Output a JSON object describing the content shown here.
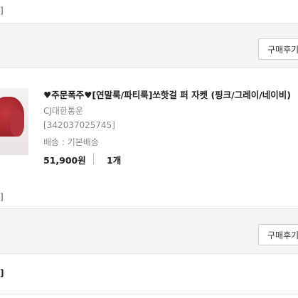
{
  "top": {
    "edge_bracket": "]"
  },
  "review_buttons": [
    {
      "label": "구매후기"
    },
    {
      "label": "구매후기"
    }
  ],
  "order_item": {
    "title": "♥주문폭주♥[연말룩/파티룩]쏘핫걸 퍼 자켓 (핑크/그레이/네이비)",
    "courier": "CJ대한통운",
    "tracking": "[342037025745]",
    "shipping": "배송 : 기본배송",
    "price": "51,900원",
    "separator": "|",
    "quantity": "1개"
  },
  "middle": {
    "edge_bracket": "]"
  },
  "bottom": {
    "edge_bracket": "]"
  },
  "colors": {
    "band": "#f4f4f4",
    "divider": "#e2e2e2",
    "muted_text": "#888888"
  }
}
